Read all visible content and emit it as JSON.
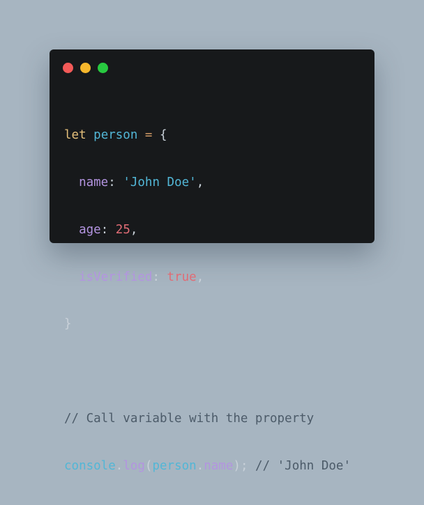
{
  "window": {
    "controls": [
      "close",
      "minimize",
      "maximize"
    ],
    "colors": {
      "close": "#f35a58",
      "minimize": "#f6b72c",
      "maximize": "#28c940",
      "background": "#17191b"
    }
  },
  "code": {
    "line1": {
      "kw": "let",
      "var": "person",
      "op": "=",
      "brace": "{"
    },
    "line2": {
      "indent": "  ",
      "prop": "name",
      "colon": ":",
      "value": "'John Doe'",
      "comma": ","
    },
    "line3": {
      "indent": "  ",
      "prop": "age",
      "colon": ":",
      "value": "25",
      "comma": ","
    },
    "line4": {
      "indent": "  ",
      "prop": "isVerified",
      "colon": ":",
      "value": "true",
      "comma": ","
    },
    "line5": {
      "brace": "}"
    },
    "line7": {
      "comment": "// Call variable with the property"
    },
    "line8": {
      "obj": "console",
      "dot1": ".",
      "fn": "log",
      "paren_open": "(",
      "arg_obj": "person",
      "dot2": ".",
      "arg_prop": "name",
      "paren_close": ")",
      "semi": ";",
      "comment": "// 'John Doe'"
    }
  }
}
